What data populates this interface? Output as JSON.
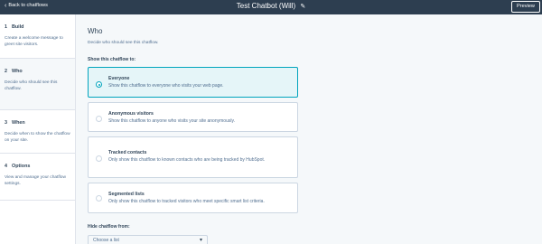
{
  "topbar": {
    "back_label": "Back to chatflows",
    "title": "Test Chatbot (Will)",
    "preview_label": "Preview",
    "background": "#2d3e50"
  },
  "sidebar": {
    "steps": [
      {
        "num": "1",
        "label": "Build",
        "desc": "Create a welcome message to greet site visitors.",
        "active": false
      },
      {
        "num": "2",
        "label": "Who",
        "desc": "Decide who should see this chatflow.",
        "active": true
      },
      {
        "num": "3",
        "label": "When",
        "desc": "Decide when to show the chatflow on your site.",
        "active": false
      },
      {
        "num": "4",
        "label": "Options",
        "desc": "View and manage your chatflow settings.",
        "active": false
      }
    ]
  },
  "main": {
    "title": "Who",
    "subtitle": "Decide who should see this chatflow.",
    "show_label": "Show this chatflow to:",
    "options": [
      {
        "title": "Everyone",
        "desc": "Show this chatflow to everyone who visits your web page.",
        "selected": true
      },
      {
        "title": "Anonymous visitors",
        "desc": "Show this chatflow to anyone who visits your site anonymously.",
        "selected": false
      },
      {
        "title": "Tracked contacts",
        "desc": "Only show this chatflow to known contacts who are being tracked by HubSpot.",
        "selected": false
      },
      {
        "title": "Segmented lists",
        "desc": "Only show this chatflow to tracked visitors who meet specific smart list criteria.",
        "selected": false
      }
    ],
    "hide_label": "Hide chatflow from:",
    "hide_select": {
      "value": "Choose a list"
    },
    "accent_color": "#00a4bd"
  }
}
